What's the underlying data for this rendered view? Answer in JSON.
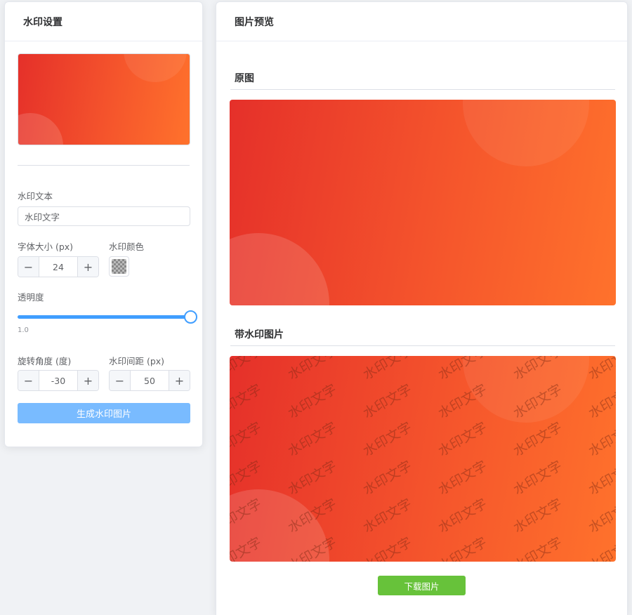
{
  "settings": {
    "title": "水印设置",
    "watermark_text_label": "水印文本",
    "watermark_text_value": "水印文字",
    "font_size_label": "字体大小 (px)",
    "font_size_value": "24",
    "color_label": "水印颜色",
    "opacity_label": "透明度",
    "opacity_value": "1.0",
    "opacity_fraction": 1.0,
    "rotation_label": "旋转角度 (度)",
    "rotation_value": "-30",
    "spacing_label": "水印间距 (px)",
    "spacing_value": "50",
    "generate_button": "生成水印图片",
    "stepper_minus": "−",
    "stepper_plus": "+"
  },
  "preview": {
    "title": "图片预览",
    "original_label": "原图",
    "watermarked_label": "带水印图片",
    "download_button": "下载图片",
    "watermark_text": "水印文字"
  },
  "colors": {
    "primary": "#409eff",
    "primary_light": "#79bbff",
    "success": "#67c23a",
    "image_gradient_start": "#e5302a",
    "image_gradient_end": "#ff722c"
  },
  "icons": {
    "color_swatch": "checkerboard-swatch-icon"
  }
}
